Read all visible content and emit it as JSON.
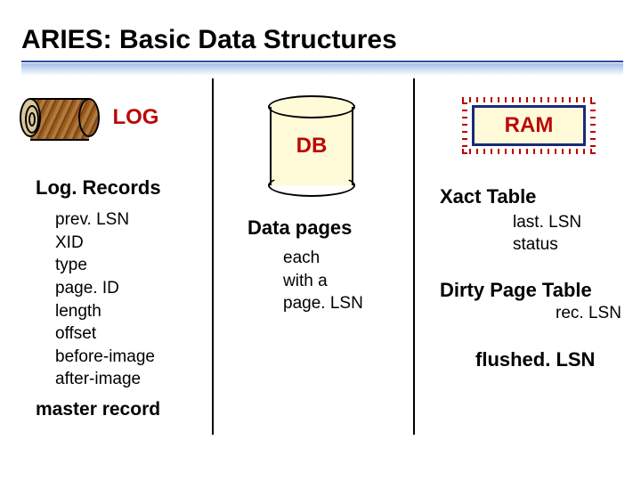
{
  "title": "ARIES:  Basic Data Structures",
  "colors": {
    "accent_red": "#bb0808",
    "underline_blue": "#2a4a9a"
  },
  "log": {
    "label": "LOG",
    "records_title": "Log. Records",
    "fields": [
      "prev. LSN",
      "XID",
      "type",
      "page. ID",
      "length",
      "offset",
      "before-image",
      "after-image"
    ],
    "master_label": "master record"
  },
  "db": {
    "label": "DB",
    "data_pages_title": "Data pages",
    "data_pages_sub": [
      "each",
      "with a",
      "page. LSN"
    ]
  },
  "ram": {
    "label": "RAM",
    "xact_table_title": "Xact Table",
    "xact_fields": [
      "last. LSN",
      "status"
    ],
    "dirty_page_table_title": "Dirty Page Table",
    "dirty_field": "rec. LSN",
    "flushed_label": "flushed. LSN"
  }
}
